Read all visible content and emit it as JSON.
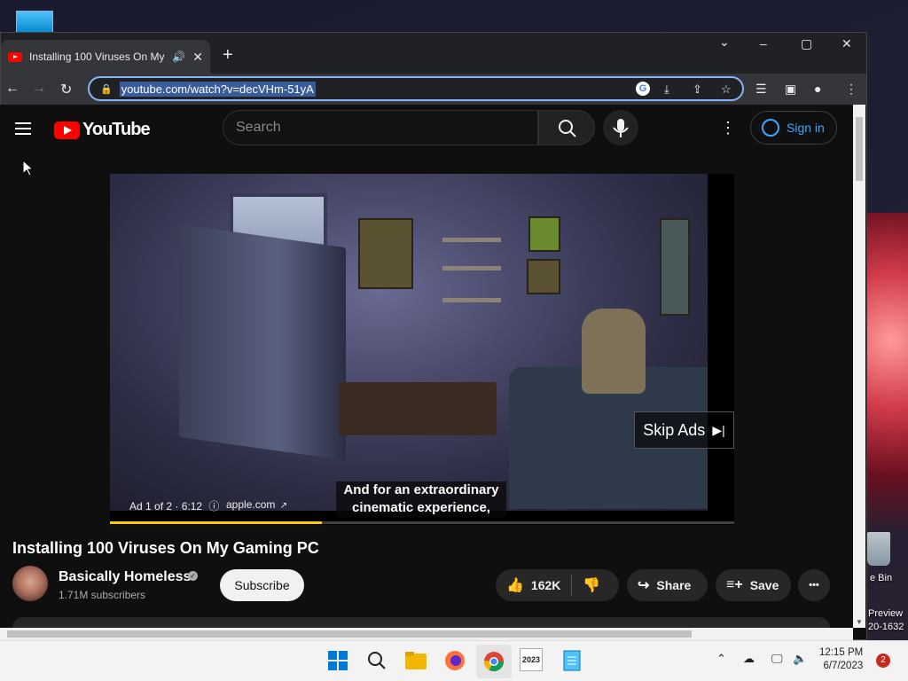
{
  "browser": {
    "tab": {
      "title": "Installing 100 Viruses On My",
      "audio_icon": "speaker-icon",
      "close": "✕"
    },
    "new_tab": "+",
    "window_controls": {
      "tab_search": "⌄",
      "minimize": "–",
      "maximize": "▢",
      "close": "✕"
    },
    "nav": {
      "back": "←",
      "forward": "→",
      "reload": "↻"
    },
    "url": "youtube.com/watch?v=decVHm-51yA"
  },
  "youtube": {
    "logo_text": "YouTube",
    "search_placeholder": "Search",
    "sign_in": "Sign in",
    "player": {
      "skip_label": "Skip Ads",
      "subtitle_line1": "And for an extraordinary",
      "subtitle_line2": "cinematic experience,",
      "ad_counter": "Ad 1 of 2 · 6:12",
      "ad_info_icon": "ⓘ",
      "ad_link": "apple.com",
      "progress_fraction": 0.34
    },
    "video_title": "Installing 100 Viruses On My Gaming PC",
    "channel": {
      "name": "Basically Homeless",
      "subscribers": "1.71M subscribers",
      "subscribe_label": "Subscribe"
    },
    "actions": {
      "likes": "162K",
      "share": "Share",
      "save": "Save",
      "more": "•••"
    }
  },
  "desktop": {
    "recycle_bin_label": "e Bin",
    "preview_label_1": "Preview",
    "preview_label_2": "20-1632"
  },
  "taskbar": {
    "time": "12:15 PM",
    "date": "6/7/2023",
    "notifications": "2",
    "calendar_year": "2023"
  },
  "colors": {
    "accent": "#8ab4f8",
    "yt_red": "#ff0000",
    "link_blue": "#3ea6ff",
    "ad_progress": "#ffcc00"
  }
}
